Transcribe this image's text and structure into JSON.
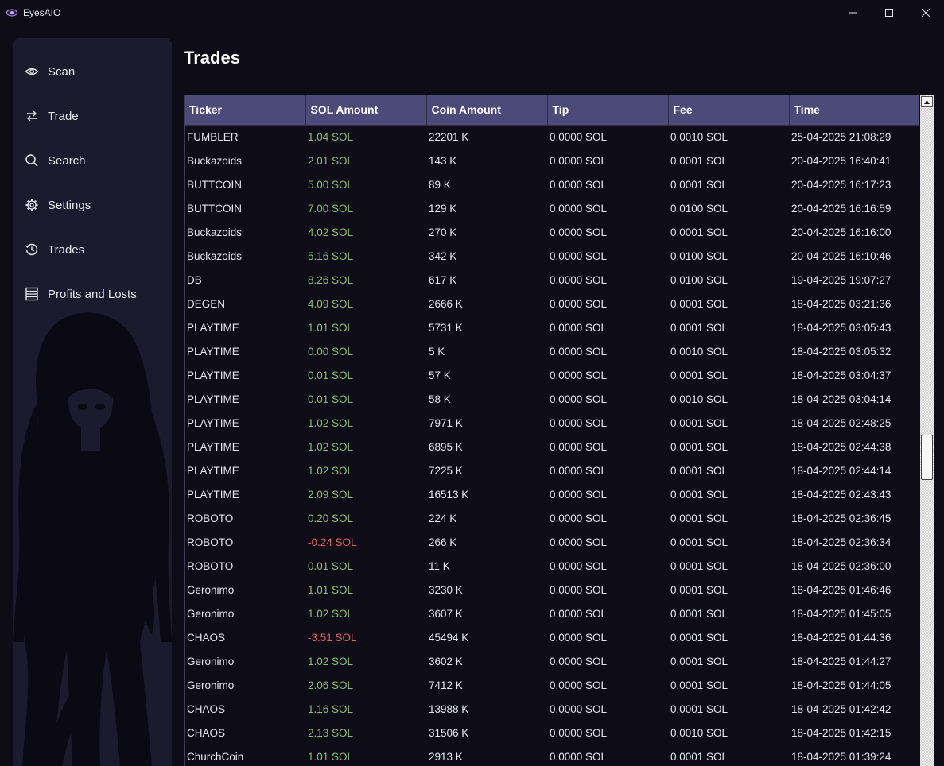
{
  "window": {
    "title": "EyesAIO",
    "icons": {
      "app": "eye-icon",
      "minimize": "minimize-icon",
      "maximize": "maximize-icon",
      "close": "close-icon"
    }
  },
  "sidebar": {
    "items": [
      {
        "label": "Scan",
        "icon": "eye-icon"
      },
      {
        "label": "Trade",
        "icon": "swap-arrows-icon"
      },
      {
        "label": "Search",
        "icon": "search-icon"
      },
      {
        "label": "Settings",
        "icon": "gear-icon"
      },
      {
        "label": "Trades",
        "icon": "history-icon"
      },
      {
        "label": "Profits and Losts",
        "icon": "ledger-icon"
      }
    ]
  },
  "main": {
    "title": "Trades",
    "table": {
      "columns": [
        "Ticker",
        "SOL Amount",
        "Coin Amount",
        "Tip",
        "Fee",
        "Time"
      ],
      "rows": [
        [
          "FUMBLER",
          "1.04 SOL",
          "22201 K",
          "0.0000 SOL",
          "0.0010 SOL",
          "25-04-2025 21:08:29"
        ],
        [
          "Buckazoids",
          "2.01 SOL",
          "143 K",
          "0.0000 SOL",
          "0.0001 SOL",
          "20-04-2025 16:40:41"
        ],
        [
          "BUTTCOIN",
          "5.00 SOL",
          "89 K",
          "0.0000 SOL",
          "0.0001 SOL",
          "20-04-2025 16:17:23"
        ],
        [
          "BUTTCOIN",
          "7.00 SOL",
          "129 K",
          "0.0000 SOL",
          "0.0100 SOL",
          "20-04-2025 16:16:59"
        ],
        [
          "Buckazoids",
          "4.02 SOL",
          "270 K",
          "0.0000 SOL",
          "0.0001 SOL",
          "20-04-2025 16:16:00"
        ],
        [
          "Buckazoids",
          "5.16 SOL",
          "342 K",
          "0.0000 SOL",
          "0.0100 SOL",
          "20-04-2025 16:10:46"
        ],
        [
          "DB",
          "8.26 SOL",
          "617 K",
          "0.0000 SOL",
          "0.0100 SOL",
          "19-04-2025 19:07:27"
        ],
        [
          "DEGEN",
          "4.09 SOL",
          "2666 K",
          "0.0000 SOL",
          "0.0001 SOL",
          "18-04-2025 03:21:36"
        ],
        [
          "PLAYTIME",
          "1.01 SOL",
          "5731 K",
          "0.0000 SOL",
          "0.0001 SOL",
          "18-04-2025 03:05:43"
        ],
        [
          "PLAYTIME",
          "0.00 SOL",
          "5 K",
          "0.0000 SOL",
          "0.0010 SOL",
          "18-04-2025 03:05:32"
        ],
        [
          "PLAYTIME",
          "0.01 SOL",
          "57 K",
          "0.0000 SOL",
          "0.0001 SOL",
          "18-04-2025 03:04:37"
        ],
        [
          "PLAYTIME",
          "0.01 SOL",
          "58 K",
          "0.0000 SOL",
          "0.0010 SOL",
          "18-04-2025 03:04:14"
        ],
        [
          "PLAYTIME",
          "1.02 SOL",
          "7971 K",
          "0.0000 SOL",
          "0.0001 SOL",
          "18-04-2025 02:48:25"
        ],
        [
          "PLAYTIME",
          "1.02 SOL",
          "6895 K",
          "0.0000 SOL",
          "0.0001 SOL",
          "18-04-2025 02:44:38"
        ],
        [
          "PLAYTIME",
          "1.02 SOL",
          "7225 K",
          "0.0000 SOL",
          "0.0001 SOL",
          "18-04-2025 02:44:14"
        ],
        [
          "PLAYTIME",
          "2.09 SOL",
          "16513 K",
          "0.0000 SOL",
          "0.0001 SOL",
          "18-04-2025 02:43:43"
        ],
        [
          "ROBOTO",
          "0.20 SOL",
          "224 K",
          "0.0000 SOL",
          "0.0001 SOL",
          "18-04-2025 02:36:45"
        ],
        [
          "ROBOTO",
          "-0.24 SOL",
          "266 K",
          "0.0000 SOL",
          "0.0001 SOL",
          "18-04-2025 02:36:34"
        ],
        [
          "ROBOTO",
          "0.01 SOL",
          "11 K",
          "0.0000 SOL",
          "0.0001 SOL",
          "18-04-2025 02:36:00"
        ],
        [
          "Geronimo",
          "1.01 SOL",
          "3230 K",
          "0.0000 SOL",
          "0.0001 SOL",
          "18-04-2025 01:46:46"
        ],
        [
          "Geronimo",
          "1.02 SOL",
          "3607 K",
          "0.0000 SOL",
          "0.0001 SOL",
          "18-04-2025 01:45:05"
        ],
        [
          "CHAOS",
          "-3.51 SOL",
          "45494 K",
          "0.0000 SOL",
          "0.0001 SOL",
          "18-04-2025 01:44:36"
        ],
        [
          "Geronimo",
          "1.02 SOL",
          "3602 K",
          "0.0000 SOL",
          "0.0001 SOL",
          "18-04-2025 01:44:27"
        ],
        [
          "Geronimo",
          "2.06 SOL",
          "7412 K",
          "0.0000 SOL",
          "0.0001 SOL",
          "18-04-2025 01:44:05"
        ],
        [
          "CHAOS",
          "1.16 SOL",
          "13988 K",
          "0.0000 SOL",
          "0.0001 SOL",
          "18-04-2025 01:42:42"
        ],
        [
          "CHAOS",
          "2.13 SOL",
          "31506 K",
          "0.0000 SOL",
          "0.0010 SOL",
          "18-04-2025 01:42:15"
        ],
        [
          "ChurchCoin",
          "1.01 SOL",
          "2913 K",
          "0.0000 SOL",
          "0.0001 SOL",
          "18-04-2025 01:39:24"
        ]
      ]
    }
  },
  "colors": {
    "positive": "#8fbf6f",
    "negative": "#e2605f",
    "header": "#4b4a78",
    "sidebar": "#1c1b2e",
    "background": "#0d0c17"
  }
}
